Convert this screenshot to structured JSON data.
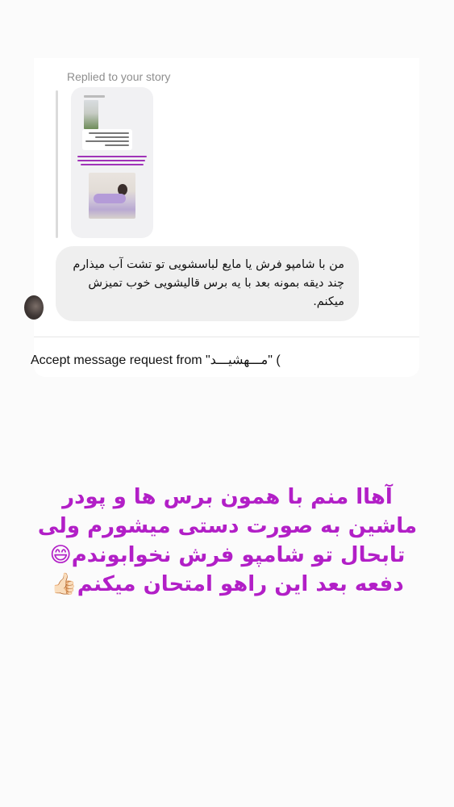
{
  "story_reply": {
    "header": "Replied to your story"
  },
  "message": {
    "text": "من با شامپو فرش یا مایع لباسشویی تو تشت آب میذارم چند دیقه بمونه بعد با یه برس قالیشویی خوب تمیزش میکنم."
  },
  "request": {
    "text": "Accept message request from \"مـــهشیـــد\" ("
  },
  "overlay": {
    "text": "آهاا منم با همون برس ها و پودر ماشین به صورت دستی میشورم ولی تابحال تو شامپو فرش نخوابوندم😄 دفعه بعد این راهو امتحان میکنم👍🏻"
  },
  "colors": {
    "overlay_text": "#b21fc7",
    "bubble_bg": "#efefef",
    "secondary_text": "#8e8e8e"
  }
}
